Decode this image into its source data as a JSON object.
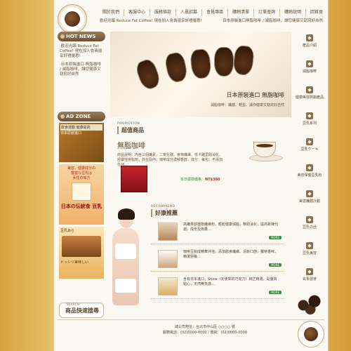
{
  "brand": {
    "logo_text": "Reduce Fat Coffee"
  },
  "topnav": [
    "關於我們",
    "客服中心",
    "服務條款",
    "人員招募",
    "會員專區",
    "購物清單",
    "訂單查詢",
    "購物說明",
    "回首頁"
  ],
  "ticker": {
    "left": "歡迎光臨 Reduce Fat Coffee! 現在加入會員還享好禮優惠!",
    "right": "日本原裝進口無脂咖啡 / 減脂咖啡，讓您健康又窈窕好自然"
  },
  "sidebar": {
    "hot_news_title": "HOT NEWS",
    "hot_news": [
      "‧歡迎光臨 Reduce Fat Coffee! 現在加入會員還享好禮優惠!",
      "‧日本原裝進口-無脂咖啡 / 減脂咖啡，讓您健康又窈窕好自然"
    ],
    "ad_zone_title": "AD ZONE",
    "ad1": {
      "head": "飲食運動 健康窈窕",
      "body": "日本原裝進口"
    },
    "ad2": {
      "line1": "美容、健康成分の",
      "line2": "豐富な豆乳は",
      "line3": "女性の味方",
      "big": "日本の伝統食 豆乳"
    },
    "ad3": {
      "line1": "豆乳あら",
      "line2": "ドッシリ美味しい"
    },
    "search": {
      "label_small": "SEARCH",
      "label_big": "商品快速搜尋"
    }
  },
  "hero": {
    "caption": "日本原裝進口 無脂咖啡",
    "subcaption": "減脂咖啡：纖體、輕盈、讓你健康又窈窕好自然"
  },
  "promo": {
    "tag": "PROMOTION",
    "title": "超值商品",
    "product_name": "無脂咖啡",
    "description": "商品說明：內含三個纖素，二氧化碳、食物纖維、低卡路里助消化、舒緩性排脂劑，外在及內；咖啡成分濃郁香醇，成分：每包：不添加任何…",
    "price_label": "本日震撼價格：",
    "price": "NT$380"
  },
  "recommend": {
    "tag": "RECOMMEND",
    "title": "好康推薦",
    "items": [
      {
        "text": "高纖果膠植物纖維粉，輕鬆健康減脂，幫助消化，提高新陳代謝，成份及用量…",
        "more": "MORE"
      },
      {
        "text": "咖啡豆製成精華沖泡，添加膳食纖維、清新口感，獨特香味，精選營養…",
        "more": "MORE"
      },
      {
        "text": "含有日本進口，Snow（天使來的巧克力）純正精選，是優質點心，天然無負擔…",
        "more": "MORE"
      }
    ]
  },
  "rightnav": [
    "產品介紹",
    "減脂咖啡",
    "健康美容熱銷產品",
    "豆乳系列",
    "豆乳ケーキ",
    "美容保健豆乳粉",
    "美容纖體計劃",
    "豆乳の話",
    "豆乳美容",
    "玄米發芽",
    "自然美研究"
  ],
  "footer": {
    "line1": "總公司地址：台北市中山區 ○○○○ 號",
    "line2": "服務電話：(02)0000-0000 / 傳真：(02)0000-0000"
  },
  "colors": {
    "accent": "#5b4630",
    "price": "#c2261d",
    "more_btn": "#3e8c3e"
  }
}
